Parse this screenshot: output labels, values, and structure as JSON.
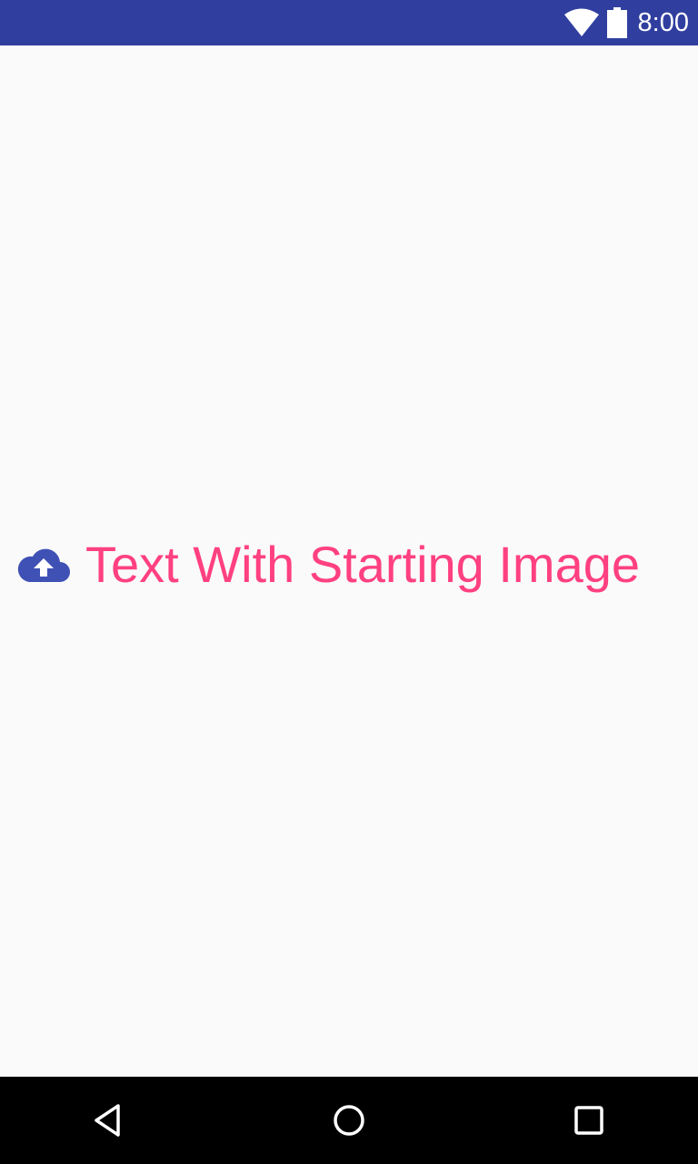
{
  "status_bar": {
    "time": "8:00",
    "background_color": "#303f9f",
    "icons": [
      "wifi-icon",
      "battery-icon"
    ]
  },
  "main": {
    "label": "Text With Starting Image",
    "label_color": "#ff4081",
    "start_icon": "cloud-upload-icon",
    "start_icon_color": "#3f51b5"
  },
  "nav_bar": {
    "buttons": [
      "back-button",
      "home-button",
      "recents-button"
    ]
  }
}
